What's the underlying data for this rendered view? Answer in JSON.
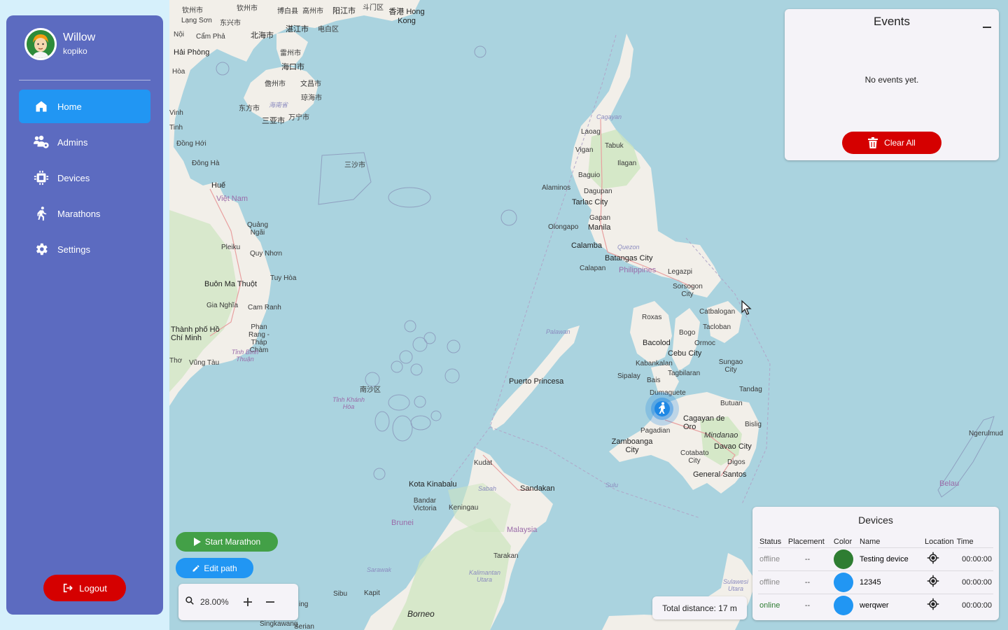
{
  "user": {
    "name": "Willow",
    "handle": "kopiko"
  },
  "nav": {
    "items": [
      {
        "label": "Home",
        "icon": "home-icon",
        "active": true
      },
      {
        "label": "Admins",
        "icon": "admins-icon"
      },
      {
        "label": "Devices",
        "icon": "chip-icon"
      },
      {
        "label": "Marathons",
        "icon": "runner-icon"
      },
      {
        "label": "Settings",
        "icon": "gear-icon"
      }
    ]
  },
  "logout_label": "Logout",
  "events": {
    "title": "Events",
    "empty_text": "No events yet.",
    "clear_label": "Clear All"
  },
  "devices": {
    "title": "Devices",
    "columns": [
      "Status",
      "Placement",
      "Color",
      "Name",
      "Location",
      "Time"
    ],
    "rows": [
      {
        "status": "offline",
        "placement": "--",
        "color": "#2e7d32",
        "name": "Testing device",
        "time": "00:00:00"
      },
      {
        "status": "offline",
        "placement": "--",
        "color": "#2196f3",
        "name": "12345",
        "time": "00:00:00"
      },
      {
        "status": "online",
        "placement": "--",
        "color": "#2196f3",
        "name": "werqwer",
        "time": "00:00:00"
      }
    ]
  },
  "controls": {
    "start_label": "Start Marathon",
    "edit_label": "Edit path",
    "zoom_value": "28.00%",
    "total_distance": "Total distance: 17 m"
  },
  "map_labels": [
    "钦州市",
    "博白县",
    "高州市",
    "阳江市",
    "斗门区",
    "香港 Hong Kong",
    "Lạng Sơn",
    "东兴市",
    "北海市",
    "湛江市",
    "电白区",
    "Cẩm Phả",
    "Hải Phòng",
    "雷州市",
    "海口市",
    "儋州市",
    "文昌市",
    "琼海市",
    "海南省",
    "东方市",
    "万宁市",
    "三亚市",
    "三沙市",
    "Đồng Hới",
    "Đông Hà",
    "Huế",
    "Việt Nam",
    "Quảng Ngãi",
    "Pleiku",
    "Quy Nhơn",
    "Buôn Ma Thuột",
    "Tuy Hòa",
    "Gia Nghĩa",
    "Cam Ranh",
    "Phan Rang - Tháp Chàm",
    "Thành phố Hồ Chí Minh",
    "Vũng Tàu",
    "Tỉnh Bình Thuận",
    "南沙区",
    "Tỉnh Khánh Hòa",
    "Cagayan",
    "Laoag",
    "Tabuk",
    "Vigan",
    "Ilagan",
    "Baguio",
    "Alaminos",
    "Dagupan",
    "Tarlac City",
    "Gapan",
    "Olongapo",
    "Manila",
    "Calamba",
    "Quezon",
    "Batangas City",
    "Calapan",
    "Philippines",
    "Legazpi",
    "Sorsogon City",
    "Catbalogan",
    "Roxas",
    "Tacloban",
    "Palawan",
    "Bacolod",
    "Bogo",
    "Ormoc",
    "Cebu City",
    "Kabankalan",
    "Tagbilaran",
    "Sungao City",
    "Sipalay",
    "Bais",
    "Dumaguete",
    "Tandag",
    "Puerto Princesa",
    "Butuan",
    "Cagayan de Oro",
    "Bislig",
    "Mindanao",
    "Pagadian",
    "Zamboanga City",
    "Davao City",
    "Cotabato City",
    "Digos",
    "General Santos",
    "Sulu",
    "Kudat",
    "Kota Kinabalu",
    "Sabah",
    "Sandakan",
    "Bandar Victoria",
    "Keningau",
    "Brunei",
    "Malaysia",
    "Tarakan",
    "Sarawak",
    "Kalimantan Utara",
    "Sibu",
    "Kapit",
    "Borneo",
    "Singkawang",
    "Serian",
    "Sulawesi Utara",
    "Belau",
    "Ngerulmud",
    "Hòa",
    "Vinh",
    "Tinh",
    "Nội",
    "Thơ",
    "Hà",
    "ing"
  ]
}
